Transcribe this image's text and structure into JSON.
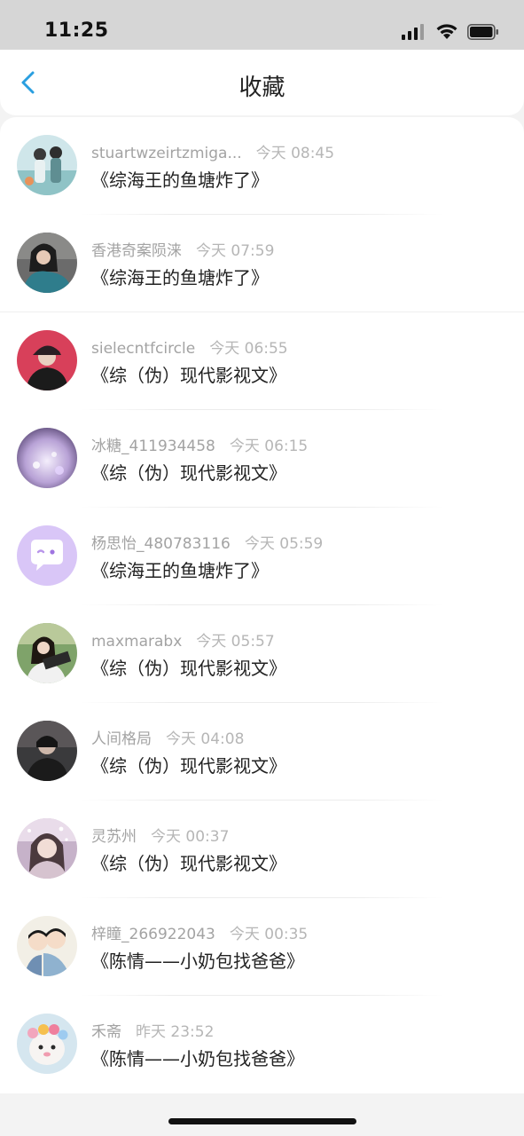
{
  "status_bar": {
    "time": "11:25"
  },
  "header": {
    "title": "收藏"
  },
  "favorites": [
    {
      "user": "stuartwzeirtzmiga...",
      "time": "今天 08:45",
      "title": "《综海王的鱼塘炸了》",
      "avatar": "avatar-illustrated-couple"
    },
    {
      "user": "香港奇案陨涞",
      "time": "今天 07:59",
      "title": "《综海王的鱼塘炸了》",
      "avatar": "avatar-woman-teal"
    },
    {
      "user": "sielecntfcircle",
      "time": "今天 06:55",
      "title": "《综（伪）现代影视文》",
      "avatar": "avatar-person-pink-cap"
    },
    {
      "user": "冰糖_411934458",
      "time": "今天 06:15",
      "title": "《综（伪）现代影视文》",
      "avatar": "avatar-purple-haze"
    },
    {
      "user": "杨思怡_480783116",
      "time": "今天 05:59",
      "title": "《综海王的鱼塘炸了》",
      "avatar": "avatar-chat-bubble-default"
    },
    {
      "user": "maxmarabx",
      "time": "今天 05:57",
      "title": "《综（伪）现代影视文》",
      "avatar": "avatar-girl-outdoors"
    },
    {
      "user": "人间格局",
      "time": "今天 04:08",
      "title": "《综（伪）现代影视文》",
      "avatar": "avatar-dark-portrait"
    },
    {
      "user": "灵苏州",
      "time": "今天 00:37",
      "title": "《综（伪）现代影视文》",
      "avatar": "avatar-woman-sparkles"
    },
    {
      "user": "梓瞳_266922043",
      "time": "今天 00:35",
      "title": "《陈情——小奶包找爸爸》",
      "avatar": "avatar-cartoon-couple"
    },
    {
      "user": "禾斋",
      "time": "昨天 23:52",
      "title": "《陈情——小奶包找爸爸》",
      "avatar": "avatar-cat-flower-crown"
    }
  ],
  "colors": {
    "accent": "#2a9fe0",
    "meta_text": "#a3a3a3",
    "title_text": "#222222",
    "default_avatar_bg": "#d9c6f7"
  }
}
